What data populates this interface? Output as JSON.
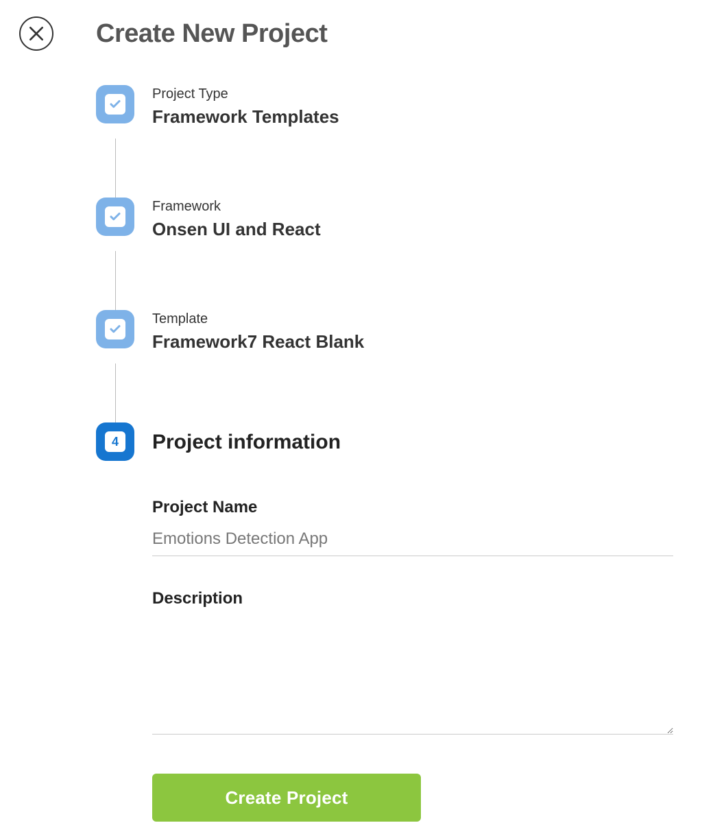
{
  "page_title": "Create New Project",
  "steps": [
    {
      "label": "Project Type",
      "value": "Framework Templates"
    },
    {
      "label": "Framework",
      "value": "Onsen UI and React"
    },
    {
      "label": "Template",
      "value": "Framework7 React Blank"
    }
  ],
  "active_step": {
    "number": "4",
    "title": "Project information"
  },
  "form": {
    "project_name_label": "Project Name",
    "project_name_value": "Emotions Detection App",
    "description_label": "Description",
    "description_value": ""
  },
  "buttons": {
    "create": "Create Project"
  }
}
